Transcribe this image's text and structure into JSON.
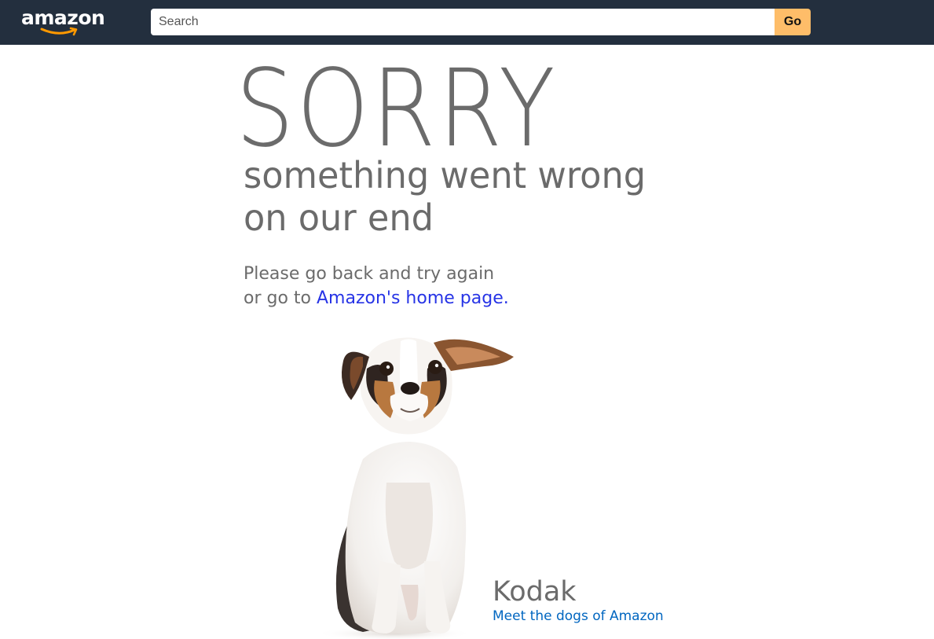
{
  "header": {
    "logo_text": "amazon",
    "search_placeholder": "Search",
    "go_label": "Go"
  },
  "error": {
    "sorry": "SORRY",
    "subhead_line1": "something went wrong",
    "subhead_line2": "on our end",
    "message_line1": "Please go back and try again",
    "message_line2_prefix": "or go to ",
    "home_link": "Amazon's home page."
  },
  "dog": {
    "name": "Kodak",
    "link": "Meet the dogs of Amazon"
  },
  "colors": {
    "navbar": "#232f3e",
    "go_button": "#febd69",
    "text": "#6b6b6b",
    "home_link": "#2734e6",
    "dogs_link": "#0066c0",
    "logo_smile": "#ff9900"
  }
}
